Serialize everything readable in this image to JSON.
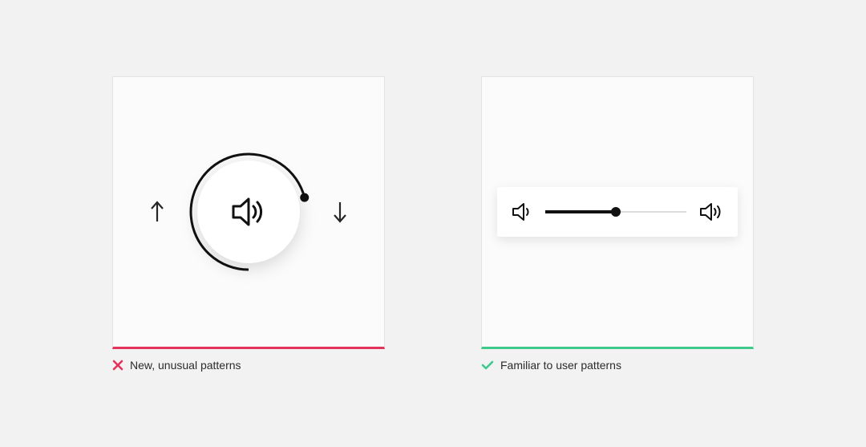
{
  "bad": {
    "caption": "New, unusual patterns",
    "dial_progress": 0.71,
    "accent": "#e4335a",
    "icons": {
      "arrow_up": "arrow-up-icon",
      "arrow_down": "arrow-down-icon",
      "speaker": "speaker-loud-icon",
      "cross": "cross-icon"
    }
  },
  "good": {
    "caption": "Familiar to user patterns",
    "slider_progress": 0.5,
    "accent": "#3fc98a",
    "icons": {
      "speaker_low": "speaker-low-icon",
      "speaker_high": "speaker-loud-icon",
      "check": "check-icon"
    }
  }
}
